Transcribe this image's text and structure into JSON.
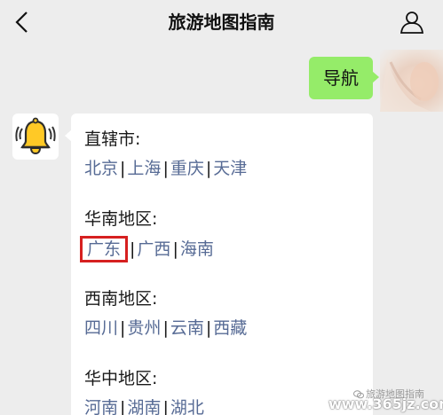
{
  "header": {
    "title": "旅游地图指南"
  },
  "chat": {
    "sent_message": "导航",
    "regions": [
      {
        "title": "直辖市:",
        "cities": [
          "北京",
          "上海",
          "重庆",
          "天津"
        ],
        "highlighted": null
      },
      {
        "title": "华南地区:",
        "cities": [
          "广东",
          "广西",
          "海南"
        ],
        "highlighted": 0
      },
      {
        "title": "西南地区:",
        "cities": [
          "四川",
          "贵州",
          "云南",
          "西藏"
        ],
        "highlighted": null
      },
      {
        "title": "华中地区:",
        "cities": [
          "河南",
          "湖南",
          "湖北"
        ],
        "highlighted": null
      }
    ],
    "separator": "|"
  },
  "watermark": {
    "text": "旅游地图指南",
    "icon": "wechat-icon"
  },
  "site_mark": "www.365jz.com",
  "icons": {
    "back": "back-chevron-icon",
    "profile": "person-icon",
    "bot": "bell-icon"
  },
  "colors": {
    "bubble_sent": "#95ec69",
    "link": "#576b95",
    "highlight": "#d62020"
  }
}
